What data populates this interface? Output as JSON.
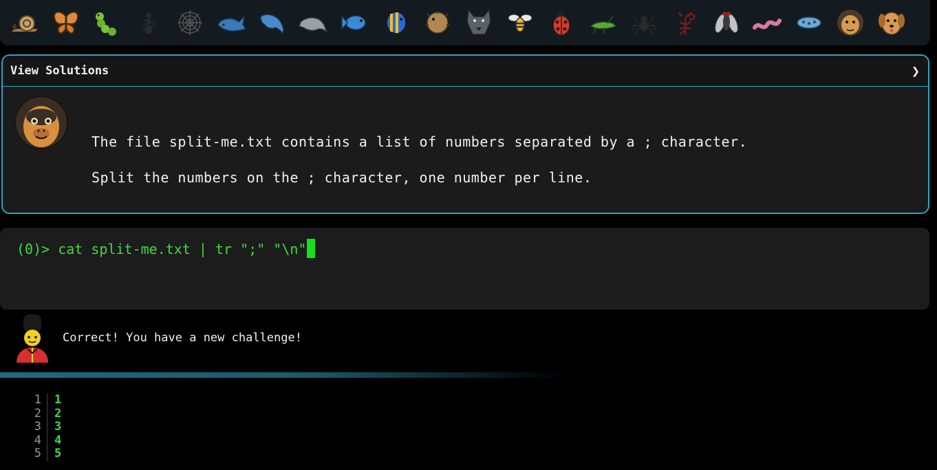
{
  "animals": [
    {
      "icon": "snail-icon"
    },
    {
      "icon": "butterfly-icon"
    },
    {
      "icon": "caterpillar-icon"
    },
    {
      "icon": "ant-icon"
    },
    {
      "icon": "spider-web-icon"
    },
    {
      "icon": "whale-icon"
    },
    {
      "icon": "dolphin-blue-icon"
    },
    {
      "icon": "dolphin-gray-icon"
    },
    {
      "icon": "fish-icon"
    },
    {
      "icon": "tropical-fish-icon"
    },
    {
      "icon": "blowfish-icon"
    },
    {
      "icon": "wolf-icon"
    },
    {
      "icon": "bee-icon"
    },
    {
      "icon": "ladybug-icon"
    },
    {
      "icon": "cricket-icon"
    },
    {
      "icon": "spider-icon"
    },
    {
      "icon": "scorpion-icon"
    },
    {
      "icon": "fly-icon"
    },
    {
      "icon": "worm-icon"
    },
    {
      "icon": "microbe-icon"
    },
    {
      "icon": "monkey-icon"
    },
    {
      "icon": "dog-icon"
    }
  ],
  "challenge": {
    "header": "View Solutions",
    "chevron": "❯",
    "lines": [
      "The file split-me.txt contains a list of numbers separated by a ; character.",
      "Split the numbers on the ; character, one number per line."
    ]
  },
  "terminal": {
    "prompt": "(0)>",
    "command": "cat split-me.txt | tr \";\" \"\\n\""
  },
  "feedback": {
    "message": "Correct! You have a new challenge!"
  },
  "output": {
    "rows": [
      {
        "line": "1",
        "value": "1"
      },
      {
        "line": "2",
        "value": "2"
      },
      {
        "line": "3",
        "value": "3"
      },
      {
        "line": "4",
        "value": "4"
      },
      {
        "line": "5",
        "value": "5"
      }
    ]
  },
  "colors": {
    "accent": "#2aa6c9",
    "terminal_green": "#3cdc3c",
    "cursor": "#18e018"
  }
}
